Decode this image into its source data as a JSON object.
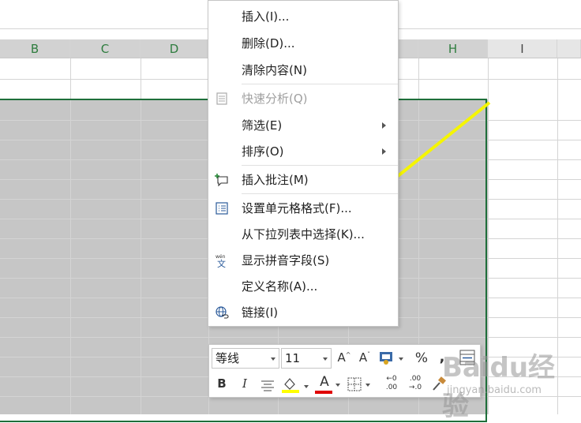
{
  "columns": [
    "B",
    "C",
    "D",
    "H",
    "I"
  ],
  "menu": {
    "items": [
      {
        "label": "插入(I)...",
        "disabled": false,
        "submenu": false
      },
      {
        "label": "删除(D)...",
        "disabled": false,
        "submenu": false
      },
      {
        "label": "清除内容(N)",
        "disabled": false,
        "submenu": false
      },
      {
        "label": "快速分析(Q)",
        "disabled": true,
        "submenu": false,
        "icon": "quick-analysis-icon"
      },
      {
        "label": "筛选(E)",
        "disabled": false,
        "submenu": true
      },
      {
        "label": "排序(O)",
        "disabled": false,
        "submenu": true
      },
      {
        "label": "插入批注(M)",
        "disabled": false,
        "submenu": false,
        "icon": "insert-comment-icon"
      },
      {
        "label": "设置单元格格式(F)...",
        "disabled": false,
        "submenu": false,
        "icon": "format-cells-icon"
      },
      {
        "label": "从下拉列表中选择(K)...",
        "disabled": false,
        "submenu": false
      },
      {
        "label": "显示拼音字段(S)",
        "disabled": false,
        "submenu": false,
        "icon": "phonetic-icon"
      },
      {
        "label": "定义名称(A)...",
        "disabled": false,
        "submenu": false
      },
      {
        "label": "链接(I)",
        "disabled": false,
        "submenu": false,
        "icon": "link-icon"
      }
    ]
  },
  "mini_toolbar": {
    "font_name": "等线",
    "font_size": "11",
    "grow_font": "A",
    "shrink_font": "A",
    "percent": "%",
    "comma": ",",
    "bold": "B",
    "italic": "I",
    "font_color_letter": "A",
    "dec_increase_top": "←0",
    "dec_increase_bottom": ".00",
    "dec_decrease_top": ".00",
    "dec_decrease_bottom": "→.0"
  },
  "colors": {
    "accent_green": "#1e6e3a",
    "highlight_yellow": "#ffff00",
    "font_red": "#e00000",
    "arrow_yellow": "#f5f500"
  },
  "watermark": {
    "main": "Baidu经验",
    "sub": "jingyan.baidu.com"
  }
}
